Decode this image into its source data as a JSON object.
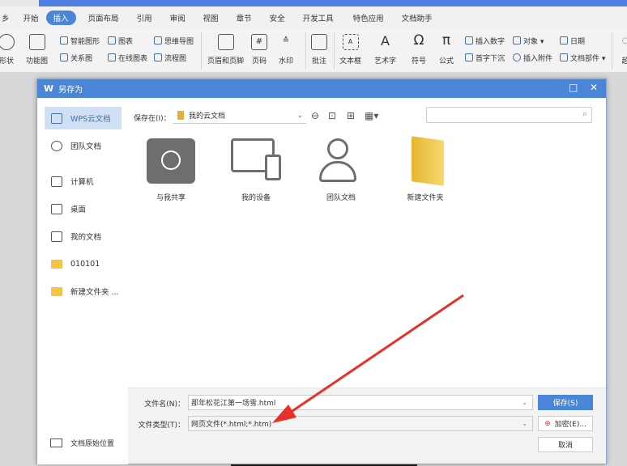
{
  "ribbon": {
    "tabs": [
      "乡",
      "开始",
      "插入",
      "页面布局",
      "引用",
      "审阅",
      "视图",
      "章节",
      "安全",
      "开发工具",
      "特色应用",
      "文档助手"
    ],
    "active_tab": "插入",
    "big_buttons": [
      "形状",
      "功能图",
      "页眉和页脚",
      "页码",
      "水印",
      "批注",
      "文本框",
      "艺术字",
      "符号",
      "公式",
      "超"
    ],
    "small_buttons": [
      "智能图形",
      "关系图",
      "图表",
      "在线图表",
      "思维导图",
      "流程图",
      "插入数字",
      "首字下沉",
      "对象",
      "插入附件",
      "日期",
      "文档部件"
    ]
  },
  "dialog": {
    "title": "另存为",
    "sidebar": [
      "WPS云文档",
      "团队文档",
      "计算机",
      "桌面",
      "我的文档",
      "010101",
      "新建文件夹 ..."
    ],
    "original_location": "文档原始位置",
    "save_in_label": "保存在(I)：",
    "save_in_value": "我的云文档",
    "search_placeholder": "",
    "items": [
      "与我共享",
      "我的设备",
      "团队文档",
      "新建文件夹"
    ],
    "filename_label": "文件名(N)：",
    "filename_value": "那年松花江第一场雪.html",
    "filetype_label": "文件类型(T)：",
    "filetype_value": "网页文件(*.html;*.htm)",
    "save_button": "保存(S)",
    "encrypt_button": "加密(E)...",
    "cancel_button": "取消"
  },
  "colors": {
    "accent": "#4a86d8",
    "arrow": "#e8302a"
  }
}
